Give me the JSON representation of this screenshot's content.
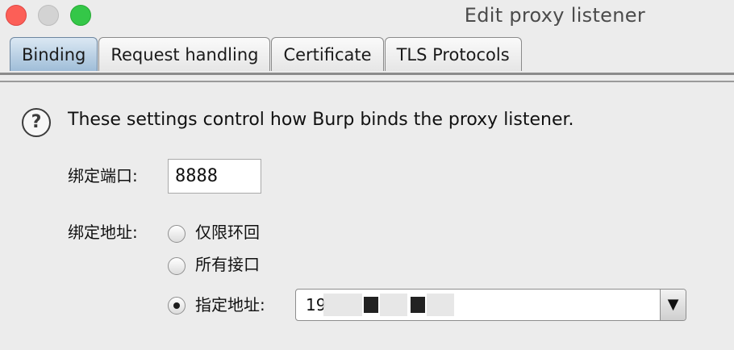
{
  "window": {
    "title": "Edit proxy listener"
  },
  "tabs": [
    {
      "label": "Binding"
    },
    {
      "label": "Request handling"
    },
    {
      "label": "Certificate"
    },
    {
      "label": "TLS Protocols"
    }
  ],
  "binding": {
    "help_text": "These settings control how Burp binds the proxy listener.",
    "port_label": "绑定端口:",
    "port_value": "8888",
    "address_label": "绑定地址:",
    "options": [
      {
        "label": "仅限环回",
        "checked": false
      },
      {
        "label": "所有接口",
        "checked": false
      },
      {
        "label": "指定地址:",
        "checked": true
      }
    ],
    "specific_address_visible": "19",
    "icons": {
      "help": "question-circle-icon",
      "dropdown": "triangle-down-icon"
    }
  }
}
